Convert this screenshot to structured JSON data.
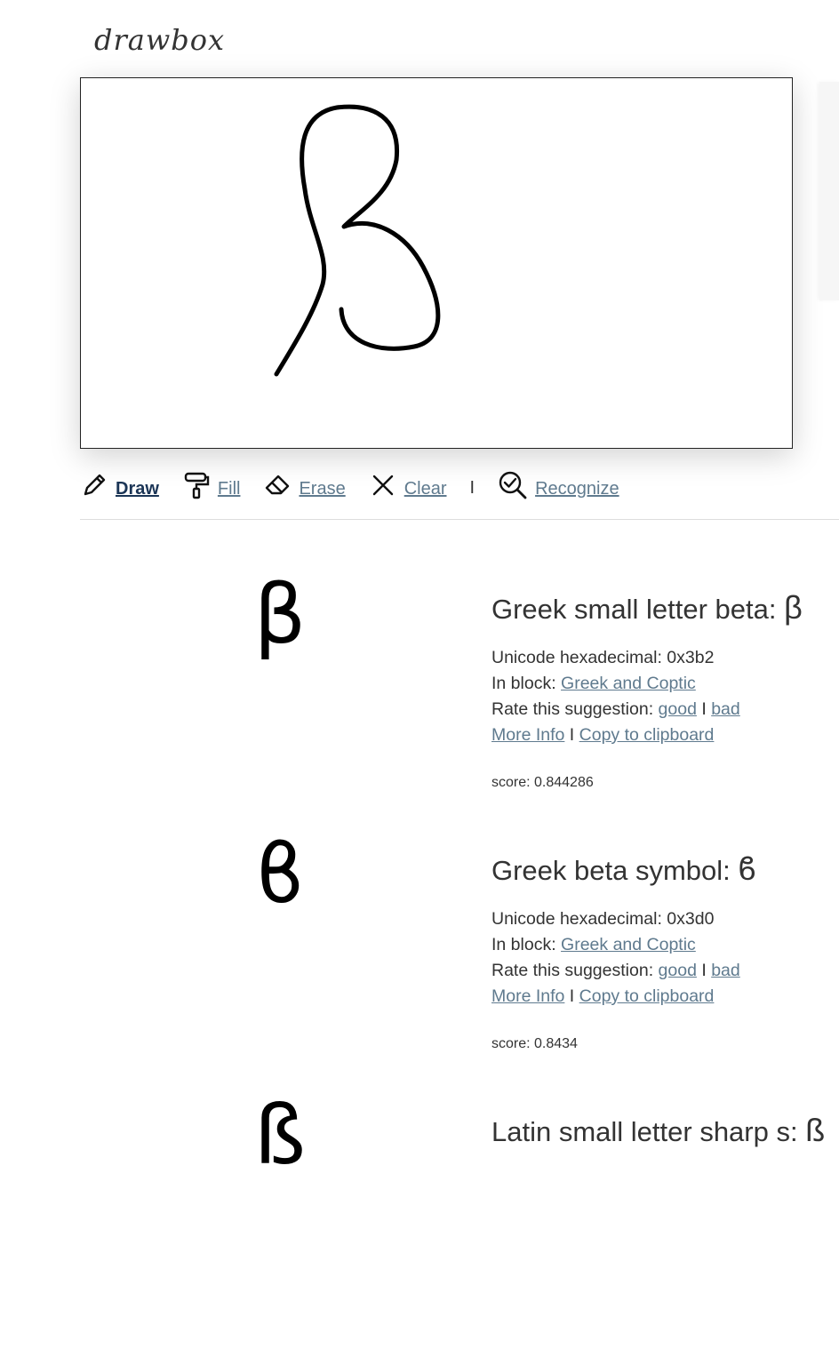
{
  "app": {
    "logo": "drawbox"
  },
  "toolbar": {
    "draw": "Draw",
    "fill": "Fill",
    "erase": "Erase",
    "clear": "Clear",
    "separator": "I",
    "recognize": "Recognize",
    "active": "draw"
  },
  "colors": {
    "link": "#5f7a8e",
    "active_link": "#1b3556",
    "text": "#333333"
  },
  "labels": {
    "unicode_hex": "Unicode hexadecimal: ",
    "in_block": "In block: ",
    "rate": "Rate this suggestion: ",
    "good": "good",
    "bad": "bad",
    "more_info": "More Info",
    "copy": "Copy to clipboard",
    "sep": "I",
    "score_prefix": "score: "
  },
  "results": [
    {
      "name": "Greek small letter beta: ",
      "char": "β",
      "hex": "0x3b2",
      "block": "Greek and Coptic",
      "score": "0.844286"
    },
    {
      "name": "Greek beta symbol: ",
      "char": "ϐ",
      "hex": "0x3d0",
      "block": "Greek and Coptic",
      "score": "0.8434"
    },
    {
      "name": "Latin small letter sharp s: ",
      "char": "ß",
      "hex": "",
      "block": "",
      "score": ""
    }
  ]
}
